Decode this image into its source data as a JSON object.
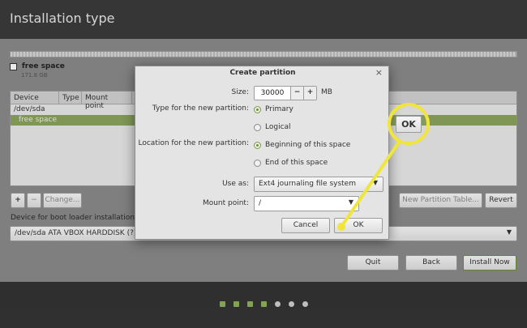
{
  "window": {
    "title": "Installation type"
  },
  "legend": {
    "name": "free space",
    "size": "171.8 GB"
  },
  "table": {
    "headers": [
      "Device",
      "Type",
      "Mount point"
    ],
    "rows": [
      {
        "device": "/dev/sda",
        "selected": false
      },
      {
        "device": "free space",
        "selected": true
      }
    ]
  },
  "partition_controls": {
    "add": "+",
    "remove": "−",
    "change": "Change...",
    "new_table": "New Partition Table...",
    "revert": "Revert"
  },
  "bootloader": {
    "label": "Device for boot loader installation:",
    "value": "/dev/sda   ATA VBOX HARDDISK (?)"
  },
  "footer_buttons": {
    "quit": "Quit",
    "back": "Back",
    "install": "Install Now"
  },
  "progress": {
    "total_steps": 7,
    "completed_steps": 4
  },
  "dialog": {
    "title": "Create partition",
    "close": "×",
    "size_label": "Size:",
    "size_value": "30000",
    "size_unit": "MB",
    "minus": "−",
    "plus": "+",
    "type_label": "Type for the new partition:",
    "type_options": [
      {
        "label": "Primary",
        "checked": true
      },
      {
        "label": "Logical",
        "checked": false
      }
    ],
    "location_label": "Location for the new partition:",
    "location_options": [
      {
        "label": "Beginning of this space",
        "checked": true
      },
      {
        "label": "End of this space",
        "checked": false
      }
    ],
    "use_as_label": "Use as:",
    "use_as_value": "Ext4 journaling file system",
    "mount_label": "Mount point:",
    "mount_value": "/",
    "cancel": "Cancel",
    "ok": "OK"
  },
  "callout": {
    "label": "OK",
    "color": "#f0e53a"
  },
  "colors": {
    "accent": "#8cb15a",
    "selection": "#8aa35f",
    "highlight": "#f0e53a"
  }
}
